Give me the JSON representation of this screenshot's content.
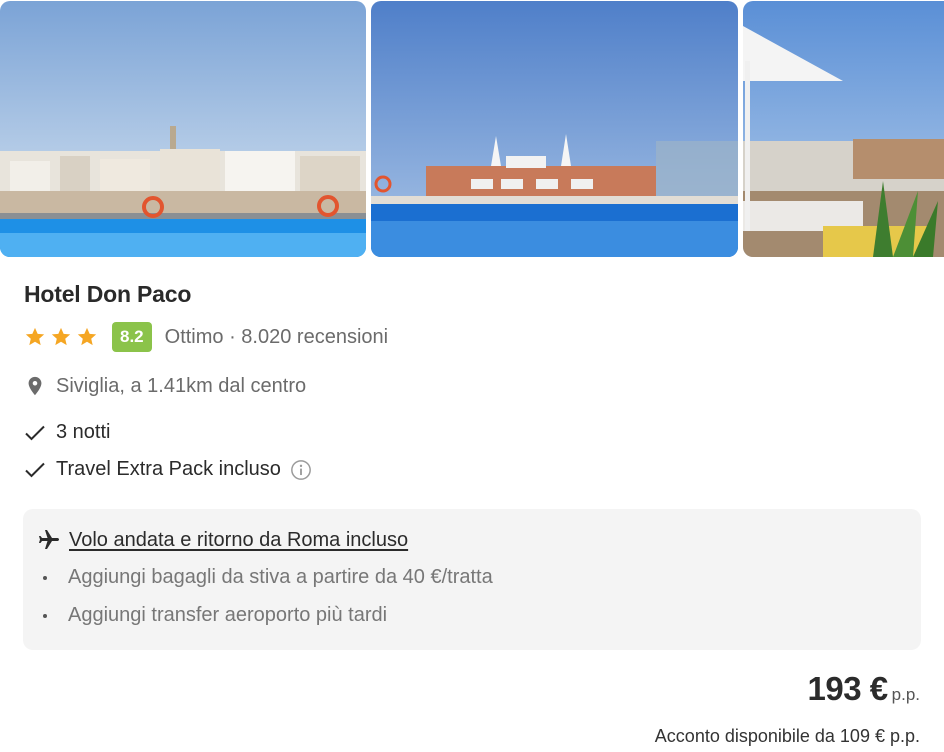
{
  "gallery": {
    "photos": [
      {
        "name": "rooftop-pool-city-view"
      },
      {
        "name": "rooftop-pool-umbrellas"
      },
      {
        "name": "terrace-loungers"
      }
    ]
  },
  "hotel": {
    "name": "Hotel Don Paco",
    "stars": 3,
    "score": "8.2",
    "rating_text": "Ottimo · 8.020 recensioni",
    "location": "Siviglia, a 1.41km dal centro",
    "features": [
      "3 notti",
      "Travel Extra Pack incluso"
    ]
  },
  "flight": {
    "title": "Volo andata e ritorno da Roma incluso",
    "extras": [
      "Aggiungi bagagli da stiva a partire da 40 €/tratta",
      "Aggiungi transfer aeroporto più tardi"
    ]
  },
  "pricing": {
    "price": "193 €",
    "unit": "p.p.",
    "deposit": "Acconto disponibile da 109 € p.p."
  },
  "colors": {
    "score_badge": "#8bc34a",
    "star": "#f5a623",
    "flight_box_bg": "#f4f4f4"
  },
  "icons": [
    "star-icon",
    "location-pin-icon",
    "check-icon",
    "info-icon",
    "airplane-icon"
  ]
}
